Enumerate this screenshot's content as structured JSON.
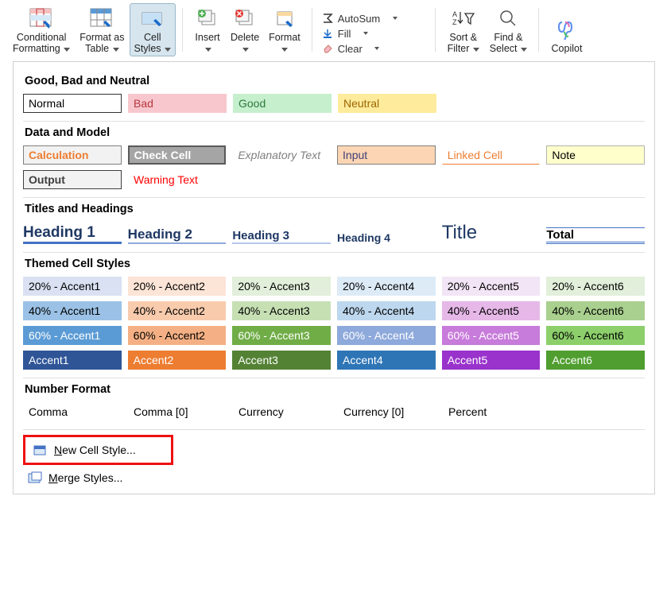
{
  "ribbon": {
    "conditional": "Conditional\nFormatting",
    "format_table": "Format as\nTable",
    "cell_styles": "Cell\nStyles",
    "insert": "Insert",
    "delete": "Delete",
    "format": "Format",
    "autosum": "AutoSum",
    "fill": "Fill",
    "clear": "Clear",
    "sort": "Sort &\nFilter",
    "find": "Find &\nSelect",
    "copilot": "Copilot"
  },
  "sections": {
    "gbn": "Good, Bad and Neutral",
    "dam": "Data and Model",
    "th": "Titles and Headings",
    "tcs": "Themed Cell Styles",
    "nf": "Number Format"
  },
  "gbn": {
    "normal": "Normal",
    "bad": "Bad",
    "good": "Good",
    "neutral": "Neutral"
  },
  "dam": {
    "calc": "Calculation",
    "check": "Check Cell",
    "expl": "Explanatory Text",
    "input": "Input",
    "linked": "Linked Cell",
    "note": "Note",
    "output": "Output",
    "warn": "Warning Text"
  },
  "th_items": {
    "h1": "Heading 1",
    "h2": "Heading 2",
    "h3": "Heading 3",
    "h4": "Heading 4",
    "title": "Title",
    "total": "Total"
  },
  "accents": {
    "r20": [
      "20% - Accent1",
      "20% - Accent2",
      "20% - Accent3",
      "20% - Accent4",
      "20% - Accent5",
      "20% - Accent6"
    ],
    "r40": [
      "40% - Accent1",
      "40% - Accent2",
      "40% - Accent3",
      "40% - Accent4",
      "40% - Accent5",
      "40% - Accent6"
    ],
    "r60": [
      "60% - Accent1",
      "60% - Accent2",
      "60% - Accent3",
      "60% - Accent4",
      "60% - Accent5",
      "60% - Accent6"
    ],
    "r100": [
      "Accent1",
      "Accent2",
      "Accent3",
      "Accent4",
      "Accent5",
      "Accent6"
    ]
  },
  "nf_items": {
    "comma": "Comma",
    "comma0": "Comma [0]",
    "currency": "Currency",
    "currency0": "Currency [0]",
    "percent": "Percent"
  },
  "menu": {
    "new": "New Cell Style...",
    "merge": "Merge Styles..."
  }
}
